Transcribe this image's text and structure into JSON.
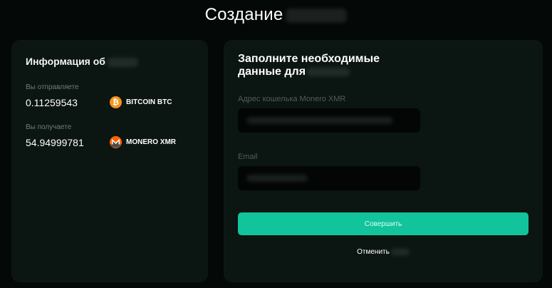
{
  "page": {
    "title": "Создание"
  },
  "info": {
    "title": "Информация об",
    "send_label": "Вы отправляете",
    "send_amount": "0.11259543",
    "send_coin": "BITCOIN BTC",
    "send_coin_icon": "bitcoin-icon",
    "receive_label": "Вы получаете",
    "receive_amount": "54.94999781",
    "receive_coin": "MONERO XMR",
    "receive_coin_icon": "monero-icon"
  },
  "form": {
    "title_line1": "Заполните необходимые",
    "title_line2": "данные для",
    "wallet_label": "Адрес кошелька Monero XMR",
    "email_label": "Email",
    "submit_label": "Совершить",
    "cancel_label": "Отменить"
  },
  "colors": {
    "background": "#040806",
    "card": "#0b1511",
    "accent": "#12c49c",
    "bitcoin": "#f7931a",
    "monero": "#ff6600"
  }
}
